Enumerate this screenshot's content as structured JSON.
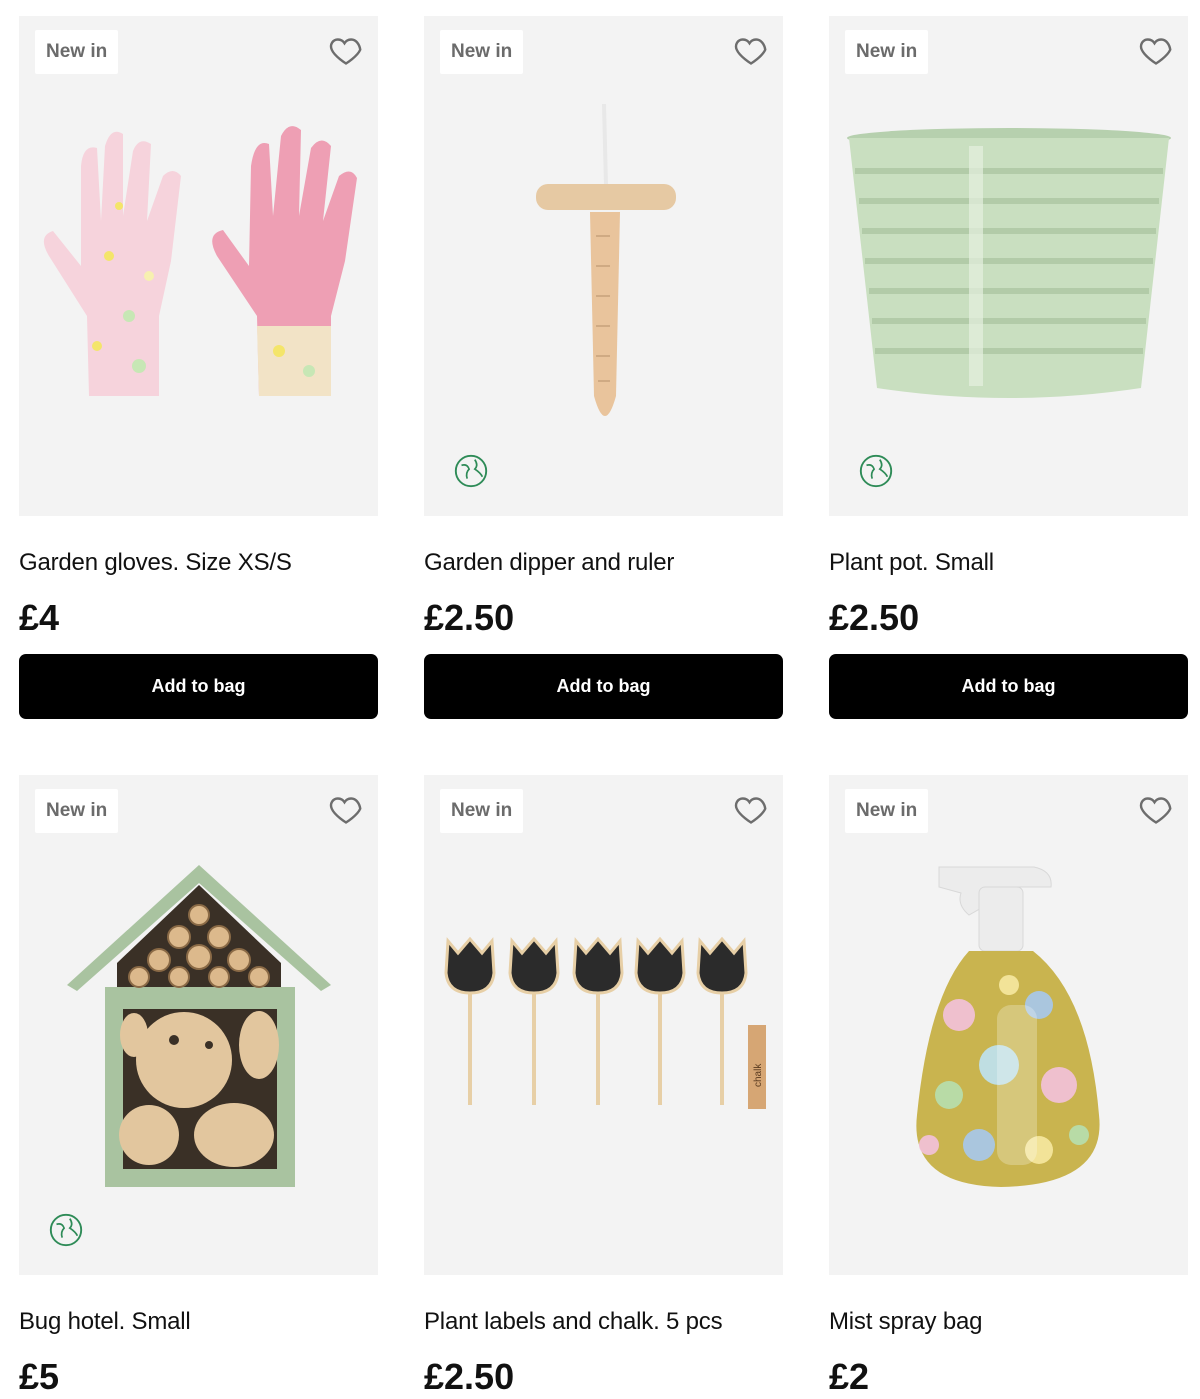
{
  "products": [
    {
      "badge": "New in",
      "name": "Garden gloves. Size XS/S",
      "price": "£4",
      "button": "Add to bag",
      "eco": false,
      "heart_icon": "heart-outline-icon"
    },
    {
      "badge": "New in",
      "name": "Garden dipper and ruler",
      "price": "£2.50",
      "button": "Add to bag",
      "eco": true,
      "heart_icon": "heart-outline-icon"
    },
    {
      "badge": "New in",
      "name": "Plant pot. Small",
      "price": "£2.50",
      "button": "Add to bag",
      "eco": true,
      "heart_icon": "heart-outline-icon"
    },
    {
      "badge": "New in",
      "name": "Bug hotel. Small",
      "price": "£5",
      "eco": true,
      "heart_icon": "heart-outline-icon"
    },
    {
      "badge": "New in",
      "name": "Plant labels and chalk. 5 pcs",
      "price": "£2.50",
      "eco": false,
      "chalk_label": "chalk",
      "heart_icon": "heart-outline-icon"
    },
    {
      "badge": "New in",
      "name": "Mist spray bag",
      "price": "£2",
      "eco": false,
      "heart_icon": "heart-outline-icon"
    }
  ],
  "colors": {
    "button_bg": "#000000",
    "button_text": "#ffffff",
    "image_bg": "#f3f3f3",
    "eco_green": "#2e8b57"
  }
}
